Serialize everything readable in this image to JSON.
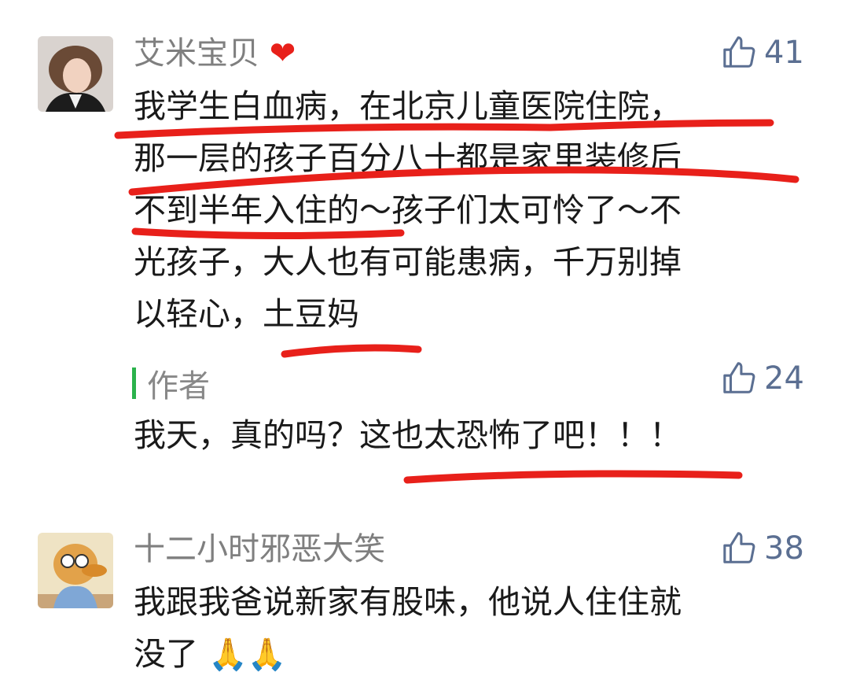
{
  "comments": [
    {
      "nickname": "艾米宝贝",
      "emoji": "❤",
      "likes": "41",
      "lines": [
        "我学生白血病，在北京儿童医院住院，",
        "那一层的孩子百分八十都是家里装修后",
        "不到半年入住的～孩子们太可怜了～不",
        "光孩子，大人也有可能患病，千万别掉",
        "以轻心，土豆妈"
      ],
      "reply": {
        "tag": "作者",
        "likes": "24",
        "text": "我天，真的吗？这也太恐怖了吧！！！"
      }
    },
    {
      "nickname": "十二小时邪恶大笑",
      "likes": "38",
      "lines": [
        "我跟我爸说新家有股味，他说人住住就",
        "没了"
      ],
      "trailing_emoji": "🙏🙏"
    }
  ],
  "colors": {
    "like": "#5b6f92",
    "author_bar": "#2bb24c",
    "annotation": "#e8201a"
  }
}
